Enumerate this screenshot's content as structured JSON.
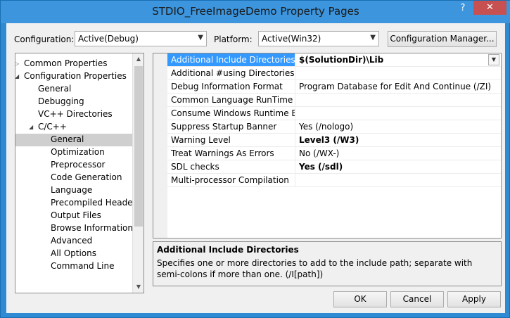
{
  "window": {
    "title": "STDIO_FreeImageDemo Property Pages",
    "help": "?",
    "close": "✕"
  },
  "toolbar": {
    "configuration_label": "Configuration:",
    "configuration_value": "Active(Debug)",
    "platform_label": "Platform:",
    "platform_value": "Active(Win32)",
    "config_manager_label": "Configuration Manager..."
  },
  "tree": {
    "items": [
      {
        "label": "Common Properties",
        "level": 0,
        "expander": "▷"
      },
      {
        "label": "Configuration Properties",
        "level": 0,
        "expander": "◢"
      },
      {
        "label": "General",
        "level": 1
      },
      {
        "label": "Debugging",
        "level": 1
      },
      {
        "label": "VC++ Directories",
        "level": 1
      },
      {
        "label": "C/C++",
        "level": 1,
        "expander": "◢"
      },
      {
        "label": "General",
        "level": 2,
        "selected": true
      },
      {
        "label": "Optimization",
        "level": 2
      },
      {
        "label": "Preprocessor",
        "level": 2
      },
      {
        "label": "Code Generation",
        "level": 2
      },
      {
        "label": "Language",
        "level": 2
      },
      {
        "label": "Precompiled Heade",
        "level": 2
      },
      {
        "label": "Output Files",
        "level": 2
      },
      {
        "label": "Browse Information",
        "level": 2
      },
      {
        "label": "Advanced",
        "level": 2
      },
      {
        "label": "All Options",
        "level": 2
      },
      {
        "label": "Command Line",
        "level": 2
      }
    ]
  },
  "grid": {
    "rows": [
      {
        "name": "Additional Include Directories",
        "value": "$(SolutionDir)\\Lib",
        "bold": true,
        "selected": true
      },
      {
        "name": "Additional #using Directories",
        "value": ""
      },
      {
        "name": "Debug Information Format",
        "value": "Program Database for Edit And Continue (/ZI)"
      },
      {
        "name": "Common Language RunTime Sup",
        "value": ""
      },
      {
        "name": "Consume Windows Runtime Exte",
        "value": ""
      },
      {
        "name": "Suppress Startup Banner",
        "value": "Yes (/nologo)"
      },
      {
        "name": "Warning Level",
        "value": "Level3 (/W3)",
        "bold": true
      },
      {
        "name": "Treat Warnings As Errors",
        "value": "No (/WX-)"
      },
      {
        "name": "SDL checks",
        "value": "Yes (/sdl)",
        "bold": true
      },
      {
        "name": "Multi-processor Compilation",
        "value": ""
      }
    ]
  },
  "description": {
    "title": "Additional Include Directories",
    "text": "Specifies one or more directories to add to the include path; separate with semi-colons if more than one.     (/I[path])"
  },
  "buttons": {
    "ok": "OK",
    "cancel": "Cancel",
    "apply": "Apply"
  }
}
